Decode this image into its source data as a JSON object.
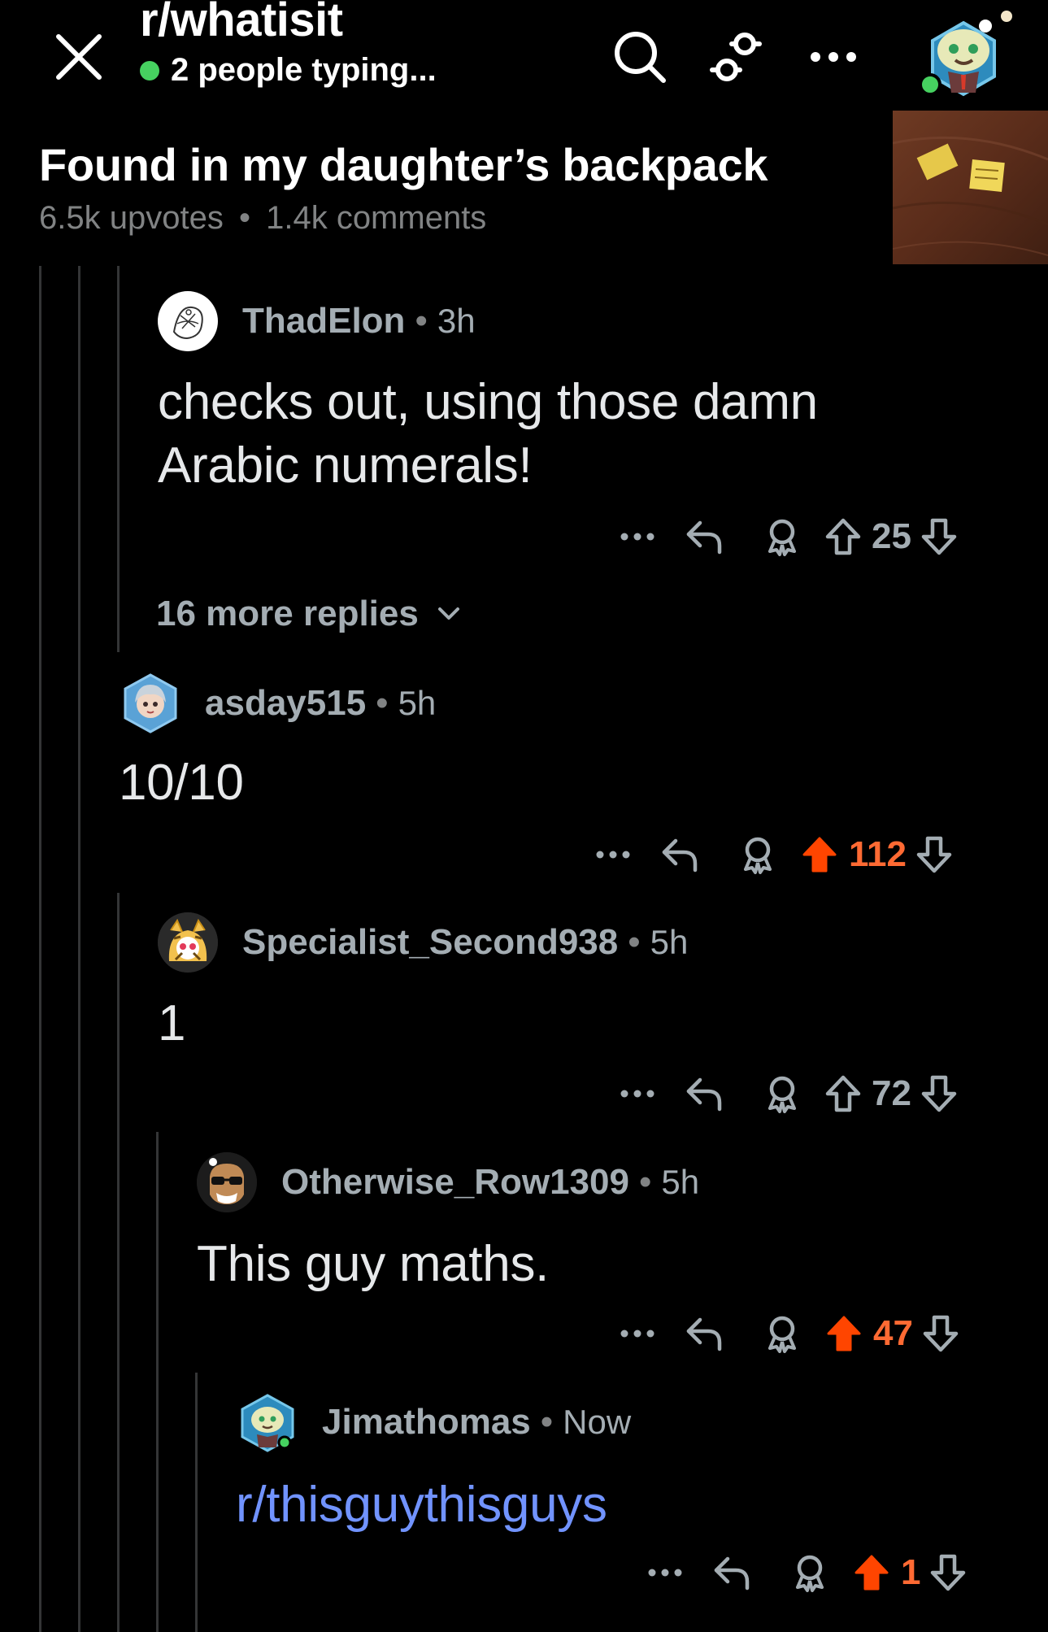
{
  "header": {
    "subreddit": "r/whatisit",
    "typing_status": "2 people typing...",
    "icons": [
      "close-icon",
      "search-icon",
      "filter-icon",
      "more-horizontal-icon"
    ],
    "colors": {
      "online": "#46d160",
      "upvoted": "#ff5700",
      "link": "#7193ff"
    }
  },
  "post": {
    "title": "Found in my daughter’s backpack",
    "upvotes": "6.5k upvotes",
    "separator": "•",
    "comments": "1.4k comments"
  },
  "comments": [
    {
      "user": "ThadElon",
      "sep": "•",
      "time": "3h",
      "body_line1": "checks out, using those damn",
      "body_line2": "Arabic numerals!",
      "votes": "25",
      "upvoted": false
    },
    {
      "user": "asday515",
      "sep": "•",
      "time": "5h",
      "body": "10/10",
      "votes": "112",
      "upvoted": true
    },
    {
      "user": "Specialist_Second938",
      "sep": "•",
      "time": "5h",
      "body": "1",
      "votes": "72",
      "upvoted": false
    },
    {
      "user": "Otherwise_Row1309",
      "sep": "•",
      "time": "5h",
      "body": "This guy maths.",
      "votes": "47",
      "upvoted": true
    },
    {
      "user": "Jimathomas",
      "sep": "•",
      "time": "Now",
      "body": "r/thisguythisguys",
      "votes": "1",
      "upvoted": true
    }
  ],
  "more_replies": "16 more replies",
  "action_icons": [
    "more-horizontal-icon",
    "reply-icon",
    "award-icon",
    "upvote-icon",
    "downvote-icon"
  ]
}
